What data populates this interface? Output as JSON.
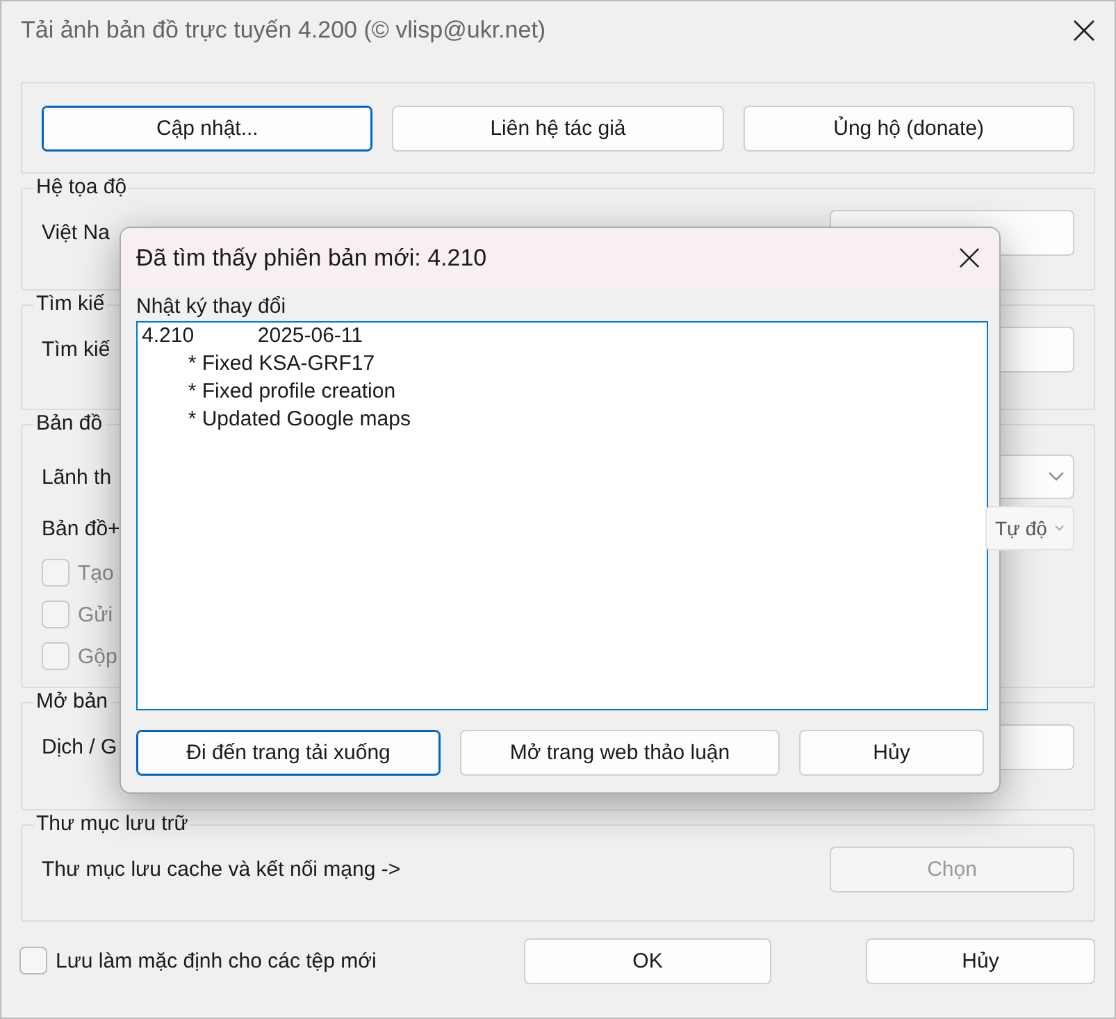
{
  "window": {
    "title": "Tải ảnh bản đồ trực tuyến 4.200 (© vlisp@ukr.net)"
  },
  "top_buttons": [
    {
      "label": "Cập nhật...",
      "focused": true
    },
    {
      "label": "Liên hệ tác giả",
      "focused": false
    },
    {
      "label": "Ủng hộ (donate)",
      "focused": false
    }
  ],
  "coordinate_group": {
    "title": "Hệ tọa độ",
    "value": "Việt Na"
  },
  "search_group": {
    "title": "Tìm kiế",
    "label": "Tìm kiế"
  },
  "map_group": {
    "title": "Bản đồ",
    "territory_label": "Lãnh th",
    "map_label": "Bản đồ+",
    "select_value": "Tự độ",
    "options": [
      {
        "label": "Tạo",
        "checked": false,
        "disabled": true
      },
      {
        "label": "Gửi",
        "checked": false,
        "disabled": true
      },
      {
        "label": "Gộp",
        "checked": false,
        "disabled": true
      }
    ]
  },
  "open_group": {
    "title": "Mở bản",
    "label": "Dịch / G"
  },
  "storage_group": {
    "title": "Thư mục lưu trữ",
    "label": "Thư mục lưu cache và kết nối mạng  ->",
    "button": {
      "label": "Chọn",
      "disabled": true
    }
  },
  "footer": {
    "default_option": {
      "label": "Lưu làm mặc định cho các tệp mới",
      "checked": false
    },
    "buttons": [
      "OK",
      "Hủy"
    ]
  },
  "dialog": {
    "title": "Đã tìm thấy phiên bản mới: 4.210",
    "log_label": "Nhật ký thay đổi",
    "log_lines": [
      "4.210           2025-06-11",
      "        * Fixed KSA-GRF17",
      "        * Fixed profile creation",
      "        * Updated Google maps"
    ],
    "buttons": [
      {
        "label": "Đi đến trang tải xuống",
        "focused": true
      },
      {
        "label": "Mở trang web thảo luận",
        "focused": false
      },
      {
        "label": "Hủy",
        "focused": false
      }
    ]
  }
}
